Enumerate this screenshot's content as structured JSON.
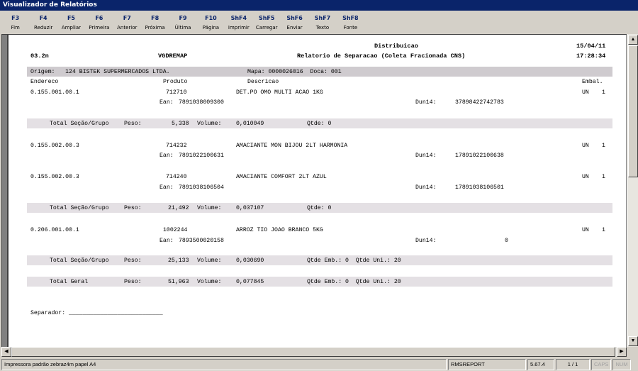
{
  "window": {
    "title": "Visualizador de Relatórios"
  },
  "toolbar": [
    {
      "key": "F3",
      "label": "Fim"
    },
    {
      "key": "F4",
      "label": "Reduzir"
    },
    {
      "key": "F5",
      "label": "Ampliar"
    },
    {
      "key": "F6",
      "label": "Primeira"
    },
    {
      "key": "F7",
      "label": "Anterior"
    },
    {
      "key": "F8",
      "label": "Próxima"
    },
    {
      "key": "F9",
      "label": "Última"
    },
    {
      "key": "F10",
      "label": "Página"
    },
    {
      "key": "ShF4",
      "label": "Imprimir"
    },
    {
      "key": "ShF5",
      "label": "Carregar"
    },
    {
      "key": "ShF6",
      "label": "Enviar"
    },
    {
      "key": "ShF7",
      "label": "Texto"
    },
    {
      "key": "ShF8",
      "label": "Fonte"
    }
  ],
  "report": {
    "header": {
      "company": "Distribuicao",
      "date": "15/04/11",
      "branch": "03.2n",
      "program": "VGDREMAP",
      "title": "Relatorio de Separacao (Coleta Fracionada CNS)",
      "time": "17:28:34"
    },
    "origin_line": "Origem:   124 BISTEK SUPERMERCADOS LTDA.",
    "map_line": "Mapa: 0000026016  Doca: 001",
    "columns": {
      "endereco": "Endereco",
      "produto": "Produto",
      "descricao": "Descricao",
      "embal": "Embal."
    },
    "items": [
      {
        "endereco": "0.155.001.00.1",
        "produto": "712710",
        "descricao": "DET.PO OMO MULTI ACAO 1KG",
        "ean_label": "Ean:",
        "ean": "7891038009300",
        "dun_label": "Dun14:",
        "dun": "37898422742783",
        "un": "UN",
        "qty": "1"
      },
      {
        "endereco": "0.155.002.00.3",
        "produto": "714232",
        "descricao": "AMACIANTE MON BIJOU 2LT HARMONIA",
        "ean_label": "Ean:",
        "ean": "7891022100631",
        "dun_label": "Dun14:",
        "dun": "17891022100638",
        "un": "UN",
        "qty": "1"
      },
      {
        "endereco": "0.155.002.00.3",
        "produto": "714240",
        "descricao": "AMACIANTE COMFORT 2LT AZUL",
        "ean_label": "Ean:",
        "ean": "7891038106504",
        "dun_label": "Dun14:",
        "dun": "17891038106501",
        "un": "UN",
        "qty": "1"
      },
      {
        "endereco": "0.206.001.00.1",
        "produto": "1002244",
        "descricao": "ARROZ TIO JOAO BRANCO 5KG",
        "ean_label": "Ean:",
        "ean": "7893500020158",
        "dun_label": "Dun14:",
        "dun": "0",
        "un": "UN",
        "qty": "1"
      }
    ],
    "totals": [
      {
        "label": "Total Seção/Grupo",
        "peso_label": "Peso:",
        "peso": "5,338",
        "volume_label": "Volume:",
        "volume": "0,010049",
        "qtde": "Qtde: 0"
      },
      {
        "label": "Total Seção/Grupo",
        "peso_label": "Peso:",
        "peso": "21,492",
        "volume_label": "Volume:",
        "volume": "0,037107",
        "qtde": "Qtde: 0"
      },
      {
        "label": "Total Seção/Grupo",
        "peso_label": "Peso:",
        "peso": "25,133",
        "volume_label": "Volume:",
        "volume": "0,030690",
        "qtde": "Qtde Emb.: 0  Qtde Uni.: 20"
      },
      {
        "label": "Total Geral",
        "peso_label": "Peso:",
        "peso": "51,963",
        "volume_label": "Volume:",
        "volume": "0,077845",
        "qtde": "Qtde Emb.: 0  Qtde Uni.: 20"
      }
    ],
    "separador": "Separador: ___________________________"
  },
  "statusbar": {
    "printer": "Impressora padrão zebraz4m papel A4",
    "module": "RMSREPORT",
    "version": "5.67.4",
    "pages": "1 / 1",
    "caps": "CAPS",
    "num": "NUM"
  },
  "icons": {
    "scroll_up": "arrow-up-icon",
    "scroll_down": "arrow-down-icon",
    "scroll_left": "arrow-left-icon",
    "scroll_right": "arrow-right-icon"
  },
  "colors": {
    "titlebar": "#0a246a",
    "band": "#e4e0e4",
    "band_dark": "#cfcbcf"
  }
}
